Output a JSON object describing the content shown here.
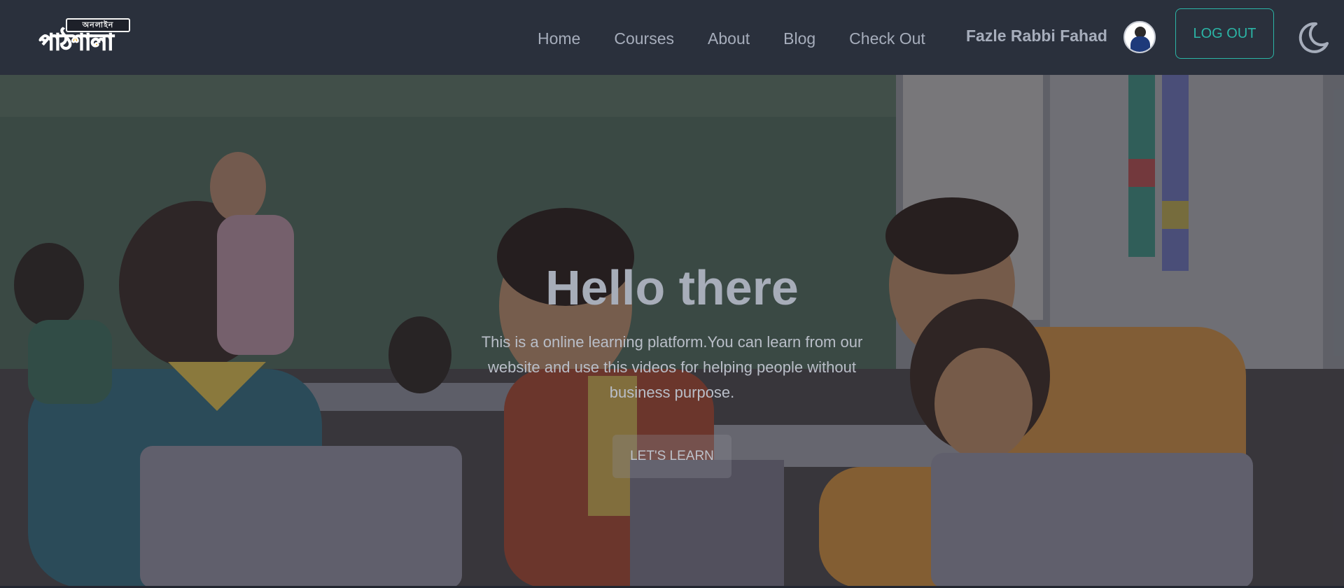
{
  "brand": {
    "logo_top_text": "অনলাইন",
    "logo_bottom_text": "পাঠশালা"
  },
  "nav": {
    "links": [
      "Home",
      "Courses",
      "About",
      "Blog",
      "Check Out"
    ],
    "user_name": "Fazle Rabbi Fahad",
    "logout_label": "LOG OUT"
  },
  "hero": {
    "title": "Hello there",
    "description": "This is a online learning platform.You can learn from our website and use this videos for helping people without business purpose.",
    "button_label": "LET'S LEARN"
  },
  "colors": {
    "navbar_bg": "#2a303c",
    "nav_text": "#a6adbb",
    "accent": "#2bb5a6",
    "logo_orange": "#f4b32b"
  },
  "icons": {
    "theme_toggle": "moon-icon",
    "user_avatar": "avatar-photo"
  }
}
